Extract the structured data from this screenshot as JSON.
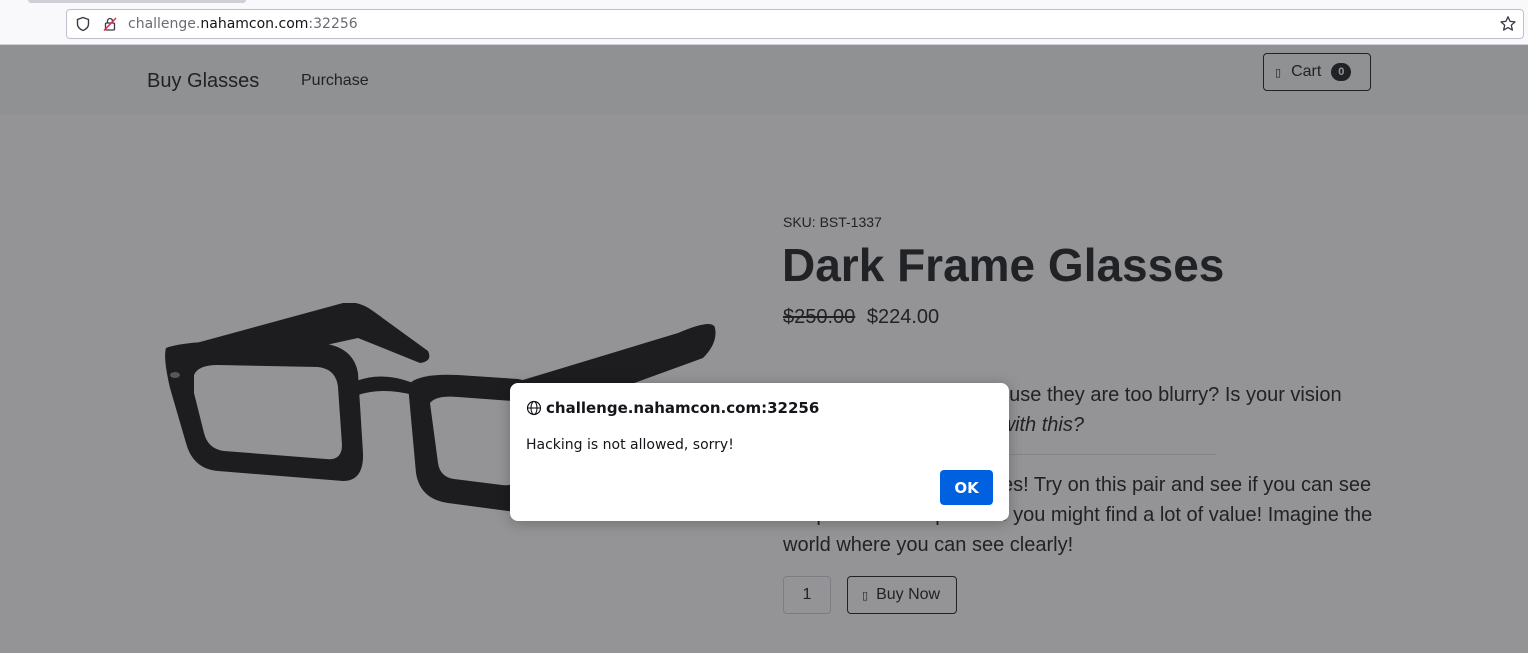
{
  "browser": {
    "url_prefix": "challenge.",
    "url_host": "nahamcon.com",
    "url_suffix": ":32256"
  },
  "navbar": {
    "brand": "Buy Glasses",
    "links": [
      {
        "label": "Purchase"
      }
    ],
    "cart": {
      "label": "Cart",
      "count": "0",
      "icon": "cart-icon"
    }
  },
  "product": {
    "sku": "SKU: BST-1337",
    "title": "Dark Frame Glasses",
    "price_old": "$250.00",
    "price_new": "$224.00",
    "desc1_plain": "Can't see your code because they are too blurry? Is your vision foggy, ",
    "desc1_italic": "do you need help with this?",
    "desc2": "Get these fantastic glasses! Try on this pair and see if you can see the previous complexities you might find a lot of value! Imagine the world where you can see clearly!",
    "quantity": "1",
    "buy_label": "Buy Now",
    "image": "glasses-image"
  },
  "dialog": {
    "origin": "challenge.nahamcon.com:32256",
    "message": "Hacking is not allowed, sorry!",
    "ok_label": "OK"
  },
  "colors": {
    "accent": "#0061e0",
    "dark": "#212529",
    "navbar_bg": "#f8f9fa"
  }
}
